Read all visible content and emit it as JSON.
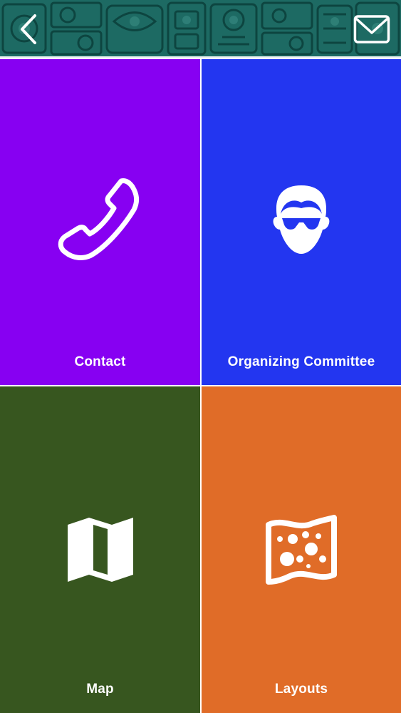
{
  "header": {
    "back_icon": "chevron-left-icon",
    "mail_icon": "envelope-icon",
    "banner": "carved-stone-banner"
  },
  "tiles": [
    {
      "label": "Contact",
      "icon": "phone-icon",
      "color": "#8700f2"
    },
    {
      "label": "Organizing Committee",
      "icon": "person-sunglasses-icon",
      "color": "#2336f0"
    },
    {
      "label": "Map",
      "icon": "folded-map-icon",
      "color": "#37561f"
    },
    {
      "label": "Layouts",
      "icon": "layout-map-icon",
      "color": "#e06c28"
    }
  ],
  "colors": {
    "header_teal": "#1f6d67",
    "contact_purple": "#8700f2",
    "committee_blue": "#2336f0",
    "map_green": "#37561f",
    "layouts_orange": "#e06c28",
    "divider": "#ffffff"
  }
}
